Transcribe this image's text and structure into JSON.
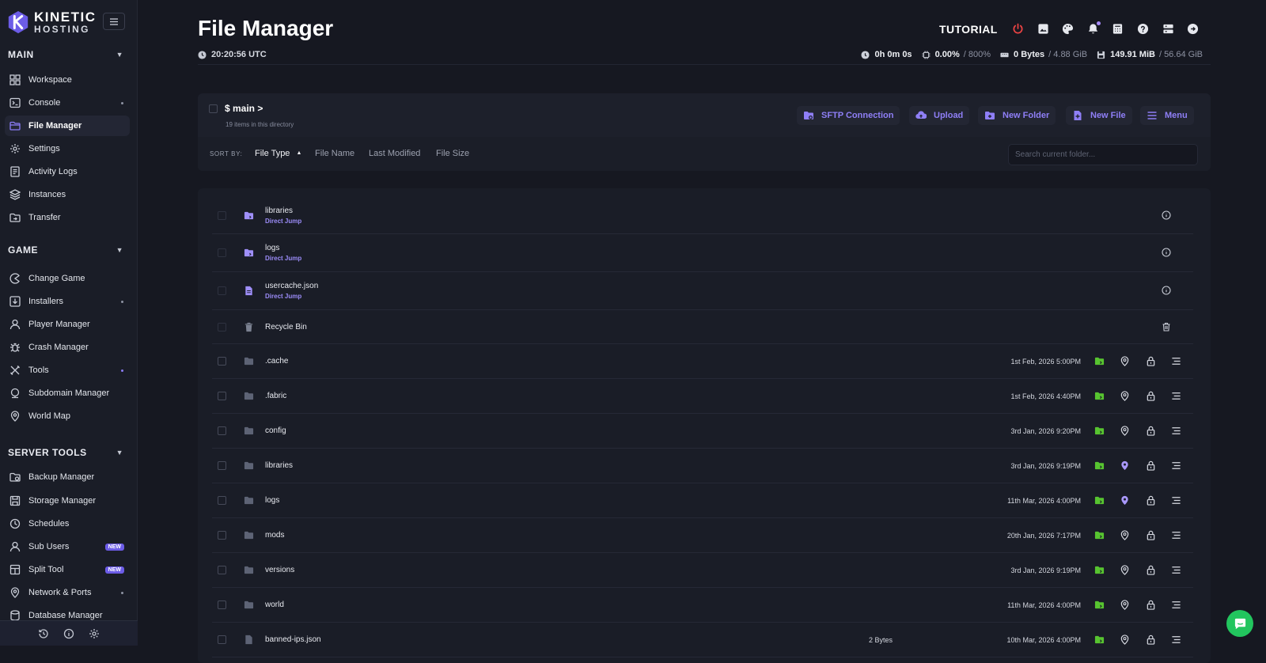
{
  "brand": {
    "line1": "KINETIC",
    "line2": "HOSTING",
    "accent": "#8b7cf6"
  },
  "sidebar": {
    "sections": [
      {
        "title": "MAIN",
        "items": [
          {
            "label": "Workspace",
            "icon": "grid-icon"
          },
          {
            "label": "Console",
            "icon": "terminal-icon",
            "dot": true
          },
          {
            "label": "File Manager",
            "icon": "folder-icon",
            "active": true
          },
          {
            "label": "Settings",
            "icon": "gear-icon"
          },
          {
            "label": "Activity Logs",
            "icon": "document-icon"
          },
          {
            "label": "Instances",
            "icon": "layers-icon"
          },
          {
            "label": "Transfer",
            "icon": "transfer-icon"
          }
        ]
      },
      {
        "title": "GAME",
        "items": [
          {
            "label": "Change Game",
            "icon": "pacman-icon"
          },
          {
            "label": "Installers",
            "icon": "download-icon",
            "dot": true
          },
          {
            "label": "Player Manager",
            "icon": "user-icon"
          },
          {
            "label": "Crash Manager",
            "icon": "bug-icon"
          },
          {
            "label": "Tools",
            "icon": "tools-icon",
            "dot": true
          },
          {
            "label": "Subdomain Manager",
            "icon": "globe-icon"
          },
          {
            "label": "World Map",
            "icon": "map-pin-icon"
          }
        ]
      },
      {
        "title": "SERVER TOOLS",
        "items": [
          {
            "label": "Backup Manager",
            "icon": "backup-icon"
          },
          {
            "label": "Storage Manager",
            "icon": "disk-icon"
          },
          {
            "label": "Schedules",
            "icon": "clock-icon"
          },
          {
            "label": "Sub Users",
            "icon": "user-icon",
            "badge": "NEW"
          },
          {
            "label": "Split Tool",
            "icon": "split-icon",
            "badge": "NEW"
          },
          {
            "label": "Network & Ports",
            "icon": "network-icon",
            "dot": true
          },
          {
            "label": "Database Manager",
            "icon": "database-icon"
          }
        ]
      }
    ]
  },
  "header": {
    "title": "File Manager",
    "time": "20:20:56 UTC",
    "tutorial": "TUTORIAL",
    "uptime": "0h 0m 0s",
    "cpu": "0.00%",
    "cpu_max": "/ 800%",
    "memory": "0 Bytes",
    "memory_max": "/ 4.88 GiB",
    "disk": "149.91 MiB",
    "disk_max": "/ 56.64 GiB",
    "power_color": "#ef4444"
  },
  "toolbar": {
    "path": "$ main >",
    "item_count": "19 items in this directory",
    "buttons": {
      "sftp": "SFTP Connection",
      "upload": "Upload",
      "new_folder": "New Folder",
      "new_file": "New File",
      "menu": "Menu"
    },
    "sort_label": "SORT BY:",
    "sort_options": {
      "type": "File Type",
      "name": "File Name",
      "modified": "Last Modified",
      "size": "File Size"
    },
    "search_placeholder": "Search current folder..."
  },
  "pinned": [
    {
      "name": "libraries",
      "jump": "Direct Jump",
      "icon": "folder-bookmark-icon"
    },
    {
      "name": "logs",
      "jump": "Direct Jump",
      "icon": "folder-bookmark-icon"
    },
    {
      "name": "usercache.json",
      "jump": "Direct Jump",
      "icon": "file-icon"
    },
    {
      "name": "Recycle Bin",
      "icon": "trash-icon"
    }
  ],
  "files": [
    {
      "name": ".cache",
      "date": "1st Feb, 2026 5:00PM",
      "size": "",
      "type": "folder"
    },
    {
      "name": ".fabric",
      "date": "1st Feb, 2026 4:40PM",
      "size": "",
      "type": "folder"
    },
    {
      "name": "config",
      "date": "3rd Jan, 2026 9:20PM",
      "size": "",
      "type": "folder"
    },
    {
      "name": "libraries",
      "date": "3rd Jan, 2026 9:19PM",
      "size": "",
      "type": "folder",
      "pinned": true
    },
    {
      "name": "logs",
      "date": "11th Mar, 2026 4:00PM",
      "size": "",
      "type": "folder",
      "pinned": true
    },
    {
      "name": "mods",
      "date": "20th Jan, 2026 7:17PM",
      "size": "",
      "type": "folder"
    },
    {
      "name": "versions",
      "date": "3rd Jan, 2026 9:19PM",
      "size": "",
      "type": "folder"
    },
    {
      "name": "world",
      "date": "11th Mar, 2026 4:00PM",
      "size": "",
      "type": "folder"
    },
    {
      "name": "banned-ips.json",
      "date": "10th Mar, 2026 4:00PM",
      "size": "2 Bytes",
      "type": "file"
    }
  ]
}
